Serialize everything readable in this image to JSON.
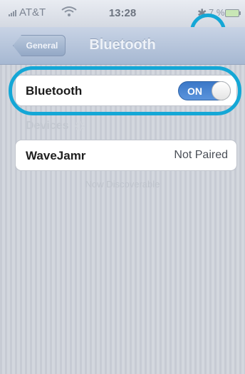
{
  "status_bar": {
    "carrier": "AT&T",
    "time": "13:28",
    "bluetooth_icon": "bluetooth-icon",
    "battery_percent": "7 %"
  },
  "nav": {
    "back_label": "General",
    "title": "Bluetooth"
  },
  "bluetooth_setting": {
    "label": "Bluetooth",
    "toggle_text": "ON",
    "enabled": true
  },
  "devices": {
    "header": "Devices",
    "items": [
      {
        "name": "WaveJamr",
        "status": "Not Paired"
      }
    ],
    "footer": "Now Discoverable"
  },
  "colors": {
    "annotation": "#14a7d6",
    "toggle_on": "#3a77c7"
  }
}
